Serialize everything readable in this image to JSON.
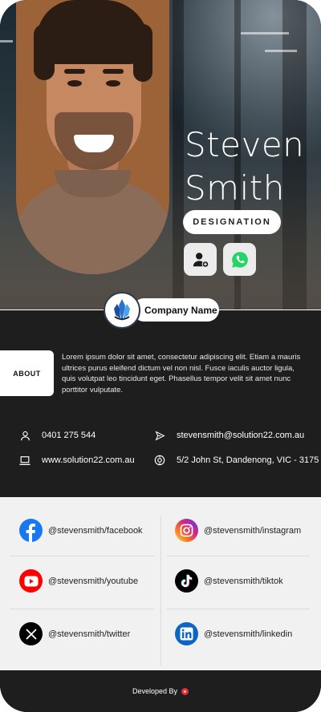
{
  "profile": {
    "first_name": "Steven",
    "last_name": "Smith",
    "designation": "DESIGNATION"
  },
  "hero_buttons": [
    {
      "icon": "add-contact-icon"
    },
    {
      "icon": "whatsapp-icon"
    }
  ],
  "company": {
    "name": "Company Name",
    "logo_icon": "company-logo-icon"
  },
  "about": {
    "tab_label": "ABOUT",
    "text": "Lorem ipsum dolor sit amet, consectetur adipiscing elit. Etiam a mauris ultrices purus eleifend dictum vel non nisl. Fusce iaculis auctor ligula, quis volutpat leo tincidunt eget. Phasellus tempor velit sit amet nunc porttitor vulputate."
  },
  "contact": {
    "phone": "0401 275 544",
    "email": "stevensmith@solution22.com.au",
    "website": "www.solution22.com.au",
    "address": "5/2 John St, Dandenong, VIC - 3175"
  },
  "social": [
    {
      "label": "@stevensmith/facebook",
      "icon": "facebook-icon",
      "color": "#1877f2"
    },
    {
      "label": "@stevensmith/instagram",
      "icon": "instagram-icon",
      "color": "#d62976"
    },
    {
      "label": "@stevensmith/youtube",
      "icon": "youtube-icon",
      "color": "#ff0000"
    },
    {
      "label": "@stevensmith/tiktok",
      "icon": "tiktok-icon",
      "color": "#000000"
    },
    {
      "label": "@stevensmith/twitter",
      "icon": "x-twitter-icon",
      "color": "#000000"
    },
    {
      "label": "@stevensmith/linkedin",
      "icon": "linkedin-icon",
      "color": "#0a66c2"
    }
  ],
  "footer": {
    "text": "Developed By"
  },
  "colors": {
    "dark_bg": "#1e1e1e",
    "social_bg": "#f1f1f1",
    "accent_blue": "#2c6fd1"
  }
}
